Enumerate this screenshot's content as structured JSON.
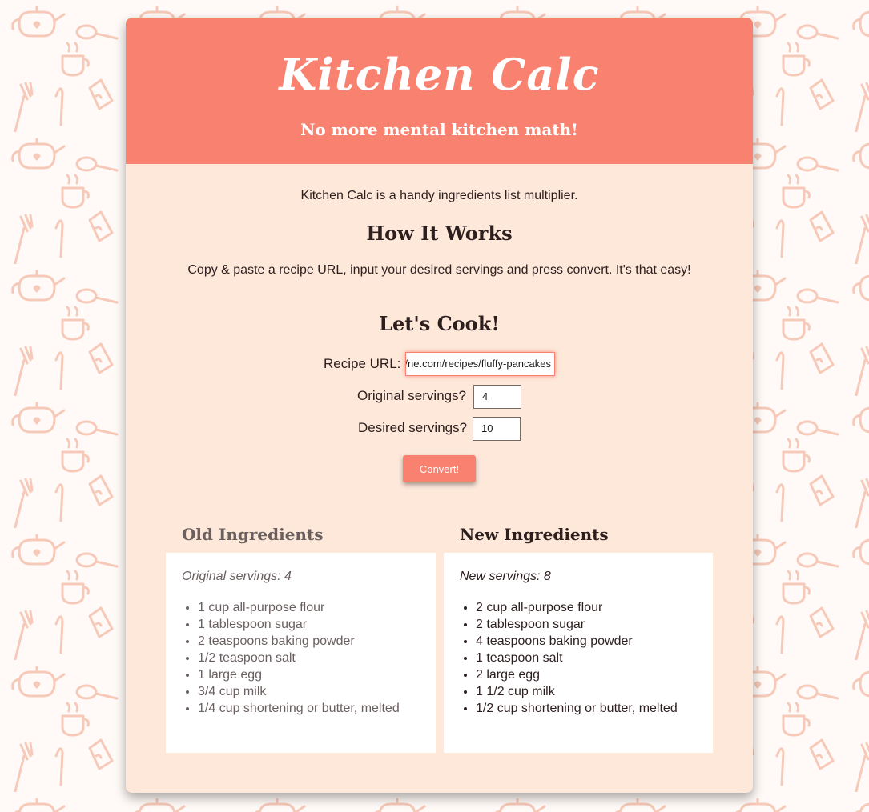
{
  "header": {
    "title": "Kitchen Calc",
    "tagline": "No more mental kitchen math!"
  },
  "intro": {
    "text": "Kitchen Calc is a handy ingredients list multiplier."
  },
  "how_it_works": {
    "heading": "How It Works",
    "text": "Copy & paste a recipe URL, input your desired servings and press convert. It's that easy!"
  },
  "form": {
    "heading": "Let's Cook!",
    "url_label": "Recipe URL:",
    "url_value": "ne.com/recipes/fluffy-pancakes/",
    "original_label": "Original servings?",
    "original_value": "4",
    "desired_label": "Desired servings?",
    "desired_value": "10",
    "convert_label": "Convert!"
  },
  "old_ingredients": {
    "heading": "Old Ingredients",
    "servings": "Original servings: 4",
    "items": [
      "1 cup all-purpose flour",
      "1 tablespoon sugar",
      "2 teaspoons baking powder",
      "1/2 teaspoon salt",
      "1 large egg",
      "3/4 cup milk",
      "1/4 cup shortening or butter, melted"
    ]
  },
  "new_ingredients": {
    "heading": "New Ingredients",
    "servings": "New servings: 8",
    "items": [
      "2 cup all-purpose flour",
      "2 tablespoon sugar",
      "4 teaspoons baking powder",
      "1 teaspoon salt",
      "2 large egg",
      "1 1/2 cup milk",
      "1/2 cup shortening or butter, melted"
    ]
  },
  "colors": {
    "accent": "#f8826f",
    "card_background": "#fde8da",
    "pattern": "#f6c9b8"
  }
}
